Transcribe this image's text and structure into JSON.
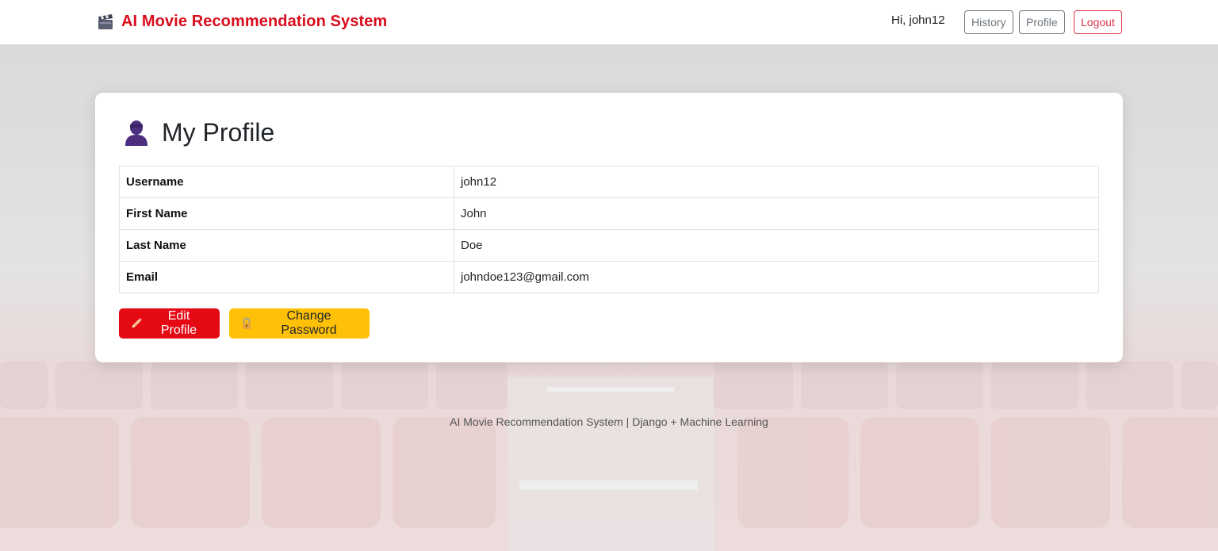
{
  "navbar": {
    "brand_icon": "clapperboard-icon",
    "brand": "AI Movie Recommendation System",
    "greeting": "Hi, john12",
    "history_label": "History",
    "profile_label": "Profile",
    "logout_label": "Logout"
  },
  "card": {
    "title_icon": "person-icon",
    "title": "My Profile",
    "rows": [
      {
        "label": "Username",
        "value": "john12"
      },
      {
        "label": "First Name",
        "value": "John"
      },
      {
        "label": "Last Name",
        "value": "Doe"
      },
      {
        "label": "Email",
        "value": "johndoe123@gmail.com"
      }
    ],
    "edit_icon": "pencil-icon",
    "edit_label": "Edit Profile",
    "password_icon": "lock-icon",
    "password_label": "Change Password"
  },
  "footer": {
    "text": "AI Movie Recommendation System | Django + Machine Learning"
  },
  "colors": {
    "brand": "#d90d1c",
    "edit_button": "#e50914",
    "password_button": "#ffc107",
    "logout": "#dc3545",
    "secondary": "#6c757d"
  }
}
